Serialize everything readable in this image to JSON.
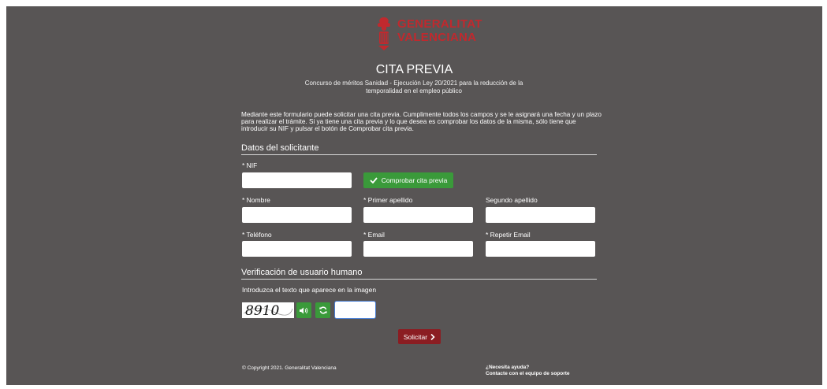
{
  "brand": {
    "line1": "GENERALITAT",
    "line2": "VALENCIANA",
    "color": "#c0292e"
  },
  "header": {
    "title": "CITA PREVIA",
    "subtitle": "Concurso de méritos Sanidad - Ejecución Ley 20/2021 para la reducción de la temporalidad en el empleo público"
  },
  "intro": "Mediante este formulario puede solicitar una cita previa. Cumplimente todos los campos y se le asignará una fecha y un plazo para realizar el trámite. Si ya tiene una cita previa y lo que desea es comprobar los datos de la misma, sólo tiene que introducir su NIF y pulsar el botón de Comprobar cita previa.",
  "applicant": {
    "section_title": "Datos del solicitante",
    "nif_label": "* NIF",
    "check_button": "Comprobar cita previa",
    "nombre_label": "* Nombre",
    "apellido1_label": "* Primer apellido",
    "apellido2_label": "Segundo apellido",
    "telefono_label": "* Teléfono",
    "email_label": "* Email",
    "email2_label": "* Repetir Email"
  },
  "verification": {
    "section_title": "Verificación de usuario humano",
    "instruction": "Introduzca el texto que aparece en la imagen",
    "captcha_text": "8910"
  },
  "submit_label": "Solicitar",
  "footer": {
    "copyright": "© Copyright 2021. Generalitat Valenciana",
    "help_title": "¿Necesita ayuda?",
    "help_link": "Contacte con el equipo de soporte"
  },
  "colors": {
    "panel_bg": "#585555",
    "success_green": "#3a9a3a",
    "submit_red": "#8b1d22"
  },
  "icons": {
    "check": "check-icon",
    "audio": "speaker-icon",
    "refresh": "refresh-icon",
    "submit": "chevron-right-icon",
    "logo": "bat-crest-icon"
  }
}
